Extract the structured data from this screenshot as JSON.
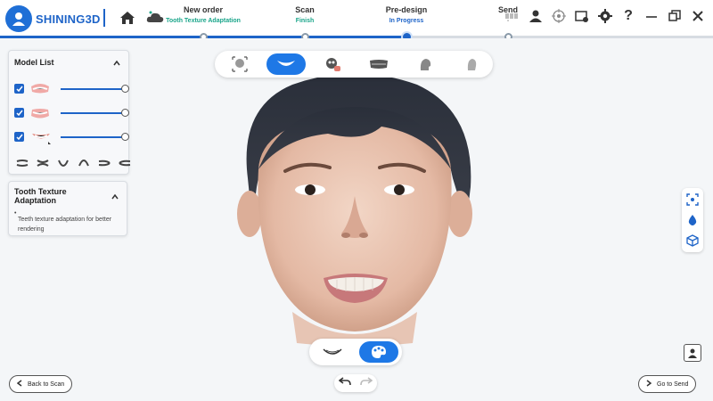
{
  "app": {
    "brand": "SHINING3D"
  },
  "workflow": {
    "steps": [
      {
        "title": "New order",
        "status": "Tooth Texture Adaptation"
      },
      {
        "title": "Scan",
        "status": "Finish"
      },
      {
        "title": "Pre-design",
        "status": "In Progress"
      },
      {
        "title": "Send",
        "status": "-"
      }
    ]
  },
  "model_list": {
    "title": "Model List",
    "items": [
      {
        "icon": "upper-jaw-icon",
        "checked": true,
        "opacity": 1.0
      },
      {
        "icon": "lower-jaw-icon",
        "checked": true,
        "opacity": 1.0
      },
      {
        "icon": "smile-model-icon",
        "checked": true,
        "opacity": 1.0
      }
    ]
  },
  "texture_panel": {
    "title": "Tooth Texture Adaptation",
    "bullet": "Teeth texture adaptation for better rendering"
  },
  "view_toolbar": {
    "items": [
      "face-scan-icon",
      "smile-icon",
      "skull-icon",
      "jaw-icon",
      "head-side-icon",
      "head-profile-icon"
    ],
    "active": "smile-icon"
  },
  "bottom_toggle": {
    "items": [
      "lip-icon",
      "palette-icon"
    ],
    "active": "palette-icon"
  },
  "navigation": {
    "back_label": "Back to Scan",
    "next_label": "Go to Send"
  },
  "colors": {
    "accent": "#1e64c8",
    "active_button": "#1e78e6",
    "status_green": "#1aa58a"
  }
}
